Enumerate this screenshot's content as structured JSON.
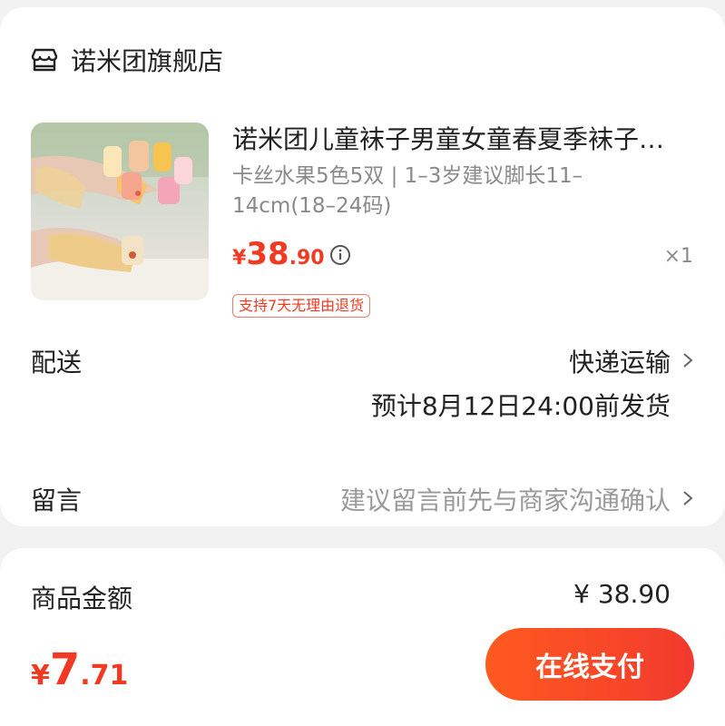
{
  "shop": {
    "name": "诺米团旗舰店",
    "icon": "shop-icon"
  },
  "product": {
    "title": "诺米团儿童袜子男童女童春夏季袜子…",
    "spec": "卡丝水果5色5双 | 1–3岁建议脚长11–14cm(18–24码)",
    "price_symbol": "¥",
    "price_int": "38",
    "price_dec": ".90",
    "quantity": "×1",
    "return_policy": "支持7天无理由退货",
    "thumbnail": "children-socks-photo"
  },
  "delivery": {
    "label": "配送",
    "method": "快递运输",
    "estimate": "预计8月12日24:00前发货"
  },
  "message": {
    "label": "留言",
    "placeholder": "建议留言前先与商家沟通确认"
  },
  "amount": {
    "label": "商品金额",
    "value": "¥ 38.90"
  },
  "checkout": {
    "total_symbol": "¥",
    "total_int": "7",
    "total_dec": ".71",
    "pay_label": "在线支付"
  },
  "colors": {
    "accent": "#f03a24",
    "button_start": "#ff5a1f",
    "button_end": "#f23a2e"
  }
}
